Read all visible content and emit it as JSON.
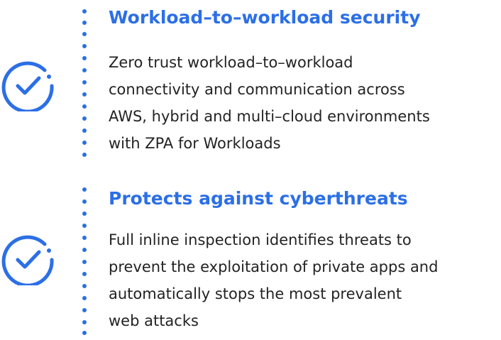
{
  "accent_color": "#2c6fe6",
  "text_color": "#232323",
  "features": [
    {
      "icon": "check-circle-icon",
      "title": "Workload–to–workload security",
      "lines": [
        "Zero trust workload–to–workload",
        "connectivity and communication across",
        "AWS, hybrid and multi–cloud environments",
        "with ZPA for Workloads"
      ]
    },
    {
      "icon": "check-circle-icon",
      "title": "Protects against cyberthreats",
      "lines": [
        "Full inline inspection identifies threats to",
        "prevent the exploitation of private apps and",
        "automatically stops the most prevalent",
        "web attacks"
      ]
    }
  ]
}
